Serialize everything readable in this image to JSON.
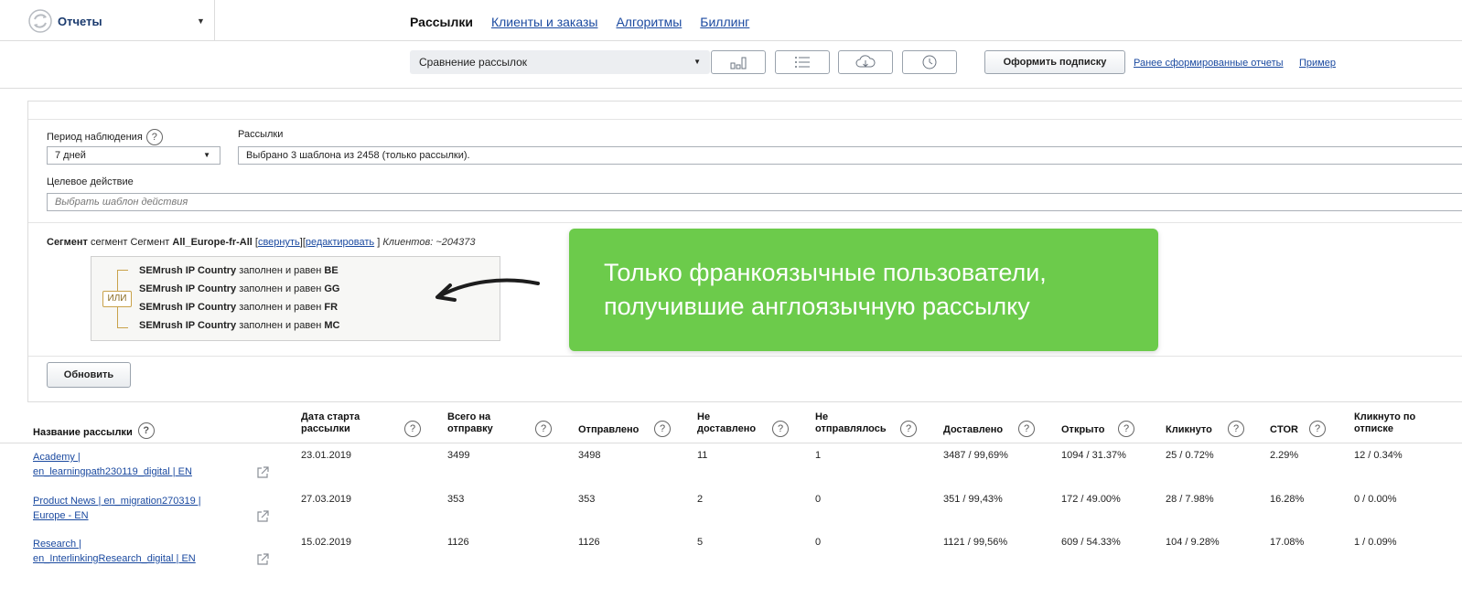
{
  "app": {
    "title": "Отчеты"
  },
  "nav": [
    {
      "label": "Рассылки",
      "active": true
    },
    {
      "label": "Клиенты и заказы",
      "active": false
    },
    {
      "label": "Алгоритмы",
      "active": false
    },
    {
      "label": "Биллинг",
      "active": false
    }
  ],
  "toolbar": {
    "report_select": "Сравнение рассылок",
    "icons": [
      "bar-chart-icon",
      "list-icon",
      "cloud-download-icon",
      "history-icon"
    ],
    "subscribe_label": "Оформить подписку",
    "previous_reports_link": "Ранее сформированные отчеты",
    "example_link": "Пример"
  },
  "filters": {
    "period_label": "Период наблюдения",
    "period_value": "7 дней",
    "mailings_label": "Рассылки",
    "mailings_value": "Выбрано 3 шаблона из 2458 (только рассылки).",
    "target_label": "Целевое действие",
    "target_placeholder": "Выбрать шаблон действия"
  },
  "segment": {
    "prefix_bold": "Сегмент",
    "prefix_text": "сегмент Сегмент",
    "name": "All_Europe-fr-All",
    "bracket_open": "[",
    "collapse_link": "свернуть",
    "mid_bracket": "][",
    "edit_link": "редактировать",
    "bracket_close": "]",
    "clients": "Клиентов: ~204373",
    "operator": "ИЛИ",
    "conditions": [
      {
        "field": "SEMrush IP Country",
        "op": "заполнен и равен",
        "value": "BE"
      },
      {
        "field": "SEMrush IP Country",
        "op": "заполнен и равен",
        "value": "GG"
      },
      {
        "field": "SEMrush IP Country",
        "op": "заполнен и равен",
        "value": "FR"
      },
      {
        "field": "SEMrush IP Country",
        "op": "заполнен и равен",
        "value": "MC"
      }
    ]
  },
  "refresh_label": "Обновить",
  "callout": {
    "line1": "Только франкоязычные пользователи,",
    "line2": "получившие англоязычную рассылку"
  },
  "table": {
    "headers": {
      "name": "Название рассылки",
      "start_l1": "Дата старта",
      "start_l2": "рассылки",
      "total_l1": "Всего на",
      "total_l2": "отправку",
      "sent": "Отправлено",
      "notdel_l1": "Не",
      "notdel_l2": "доставлено",
      "notsent_l1": "Не",
      "notsent_l2": "отправлялось",
      "delivered": "Доставлено",
      "opened": "Открыто",
      "clicked": "Кликнуто",
      "ctor": "CTOR",
      "unsub_l1": "Кликнуто по",
      "unsub_l2": "отписке"
    },
    "rows": [
      {
        "name_l1": "Academy |",
        "name_l2": "en_learningpath230119_digital | EN",
        "start": "23.01.2019",
        "total": "3499",
        "sent": "3498",
        "notdel": "11",
        "notsent": "1",
        "delivered": "3487 / 99,69%",
        "opened": "1094 / 31.37%",
        "clicked": "25 / 0.72%",
        "ctor": "2.29%",
        "unsub": "12 / 0.34%"
      },
      {
        "name_l1": "Product News | en_migration270319 |",
        "name_l2": "Europe - EN",
        "start": "27.03.2019",
        "total": "353",
        "sent": "353",
        "notdel": "2",
        "notsent": "0",
        "delivered": "351 / 99,43%",
        "opened": "172 / 49.00%",
        "clicked": "28 / 7.98%",
        "ctor": "16.28%",
        "unsub": "0 / 0.00%"
      },
      {
        "name_l1": "Research |",
        "name_l2": "en_InterlinkingResearch_digital | EN",
        "start": "15.02.2019",
        "total": "1126",
        "sent": "1126",
        "notdel": "5",
        "notsent": "0",
        "delivered": "1121 / 99,56%",
        "opened": "609 / 54.33%",
        "clicked": "104 / 9.28%",
        "ctor": "17.08%",
        "unsub": "1 / 0.09%"
      }
    ]
  }
}
